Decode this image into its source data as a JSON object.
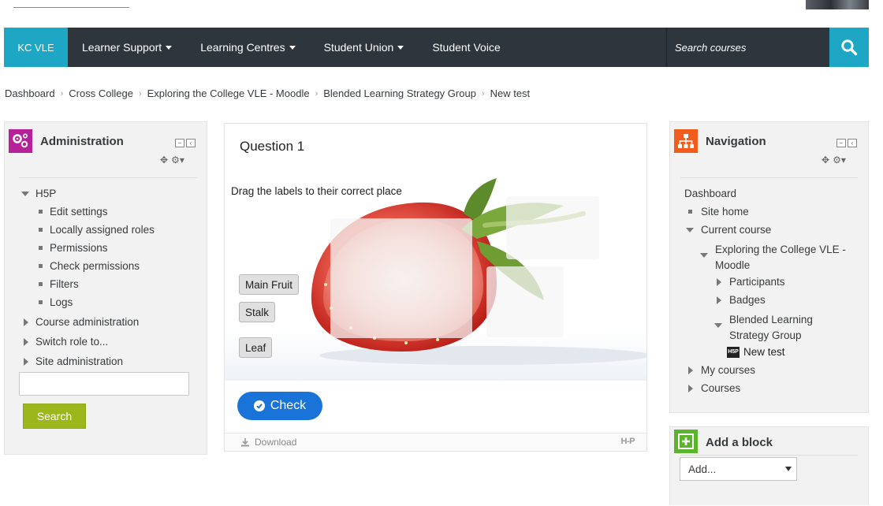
{
  "navbar": {
    "brand": "KC VLE",
    "items": [
      {
        "label": "Learner Support",
        "dropdown": true
      },
      {
        "label": "Learning Centres",
        "dropdown": true
      },
      {
        "label": "Student Union",
        "dropdown": true
      },
      {
        "label": "Student Voice",
        "dropdown": false
      }
    ],
    "search_placeholder": "Search courses"
  },
  "breadcrumb": [
    "Dashboard",
    "Cross College",
    "Exploring the College VLE - Moodle",
    "Blended Learning Strategy Group",
    "New test"
  ],
  "admin_block": {
    "title": "Administration",
    "h5p_label": "H5P",
    "h5p_items": [
      "Edit settings",
      "Locally assigned roles",
      "Permissions",
      "Check permissions",
      "Filters",
      "Logs"
    ],
    "sections": [
      "Course administration",
      "Switch role to...",
      "Site administration"
    ],
    "search_button": "Search"
  },
  "h5p": {
    "question_title": "Question 1",
    "task": "Drag the labels to their correct place",
    "labels": [
      "Main Fruit",
      "Stalk",
      "Leaf"
    ],
    "check_button": "Check",
    "download_label": "Download",
    "logo_text": "H-P"
  },
  "navigation_block": {
    "title": "Navigation",
    "dashboard": "Dashboard",
    "site_home": "Site home",
    "current_course": "Current course",
    "course_name": "Exploring the College VLE - Moodle",
    "participants": "Participants",
    "badges": "Badges",
    "section": "Blended Learning Strategy Group",
    "activity": "New test",
    "activity_badge": "H5P",
    "my_courses": "My courses",
    "courses": "Courses"
  },
  "add_block": {
    "title": "Add a block",
    "select_value": "Add..."
  },
  "colors": {
    "navbar_bg": "#2f353d",
    "accent": "#1ea7c4",
    "admin_icon": "#b6219a",
    "nav_icon": "#f25d1e",
    "addblock_icon": "#5ab52c",
    "search_button": "#9bb71c",
    "check_button": "#1a73d9"
  }
}
